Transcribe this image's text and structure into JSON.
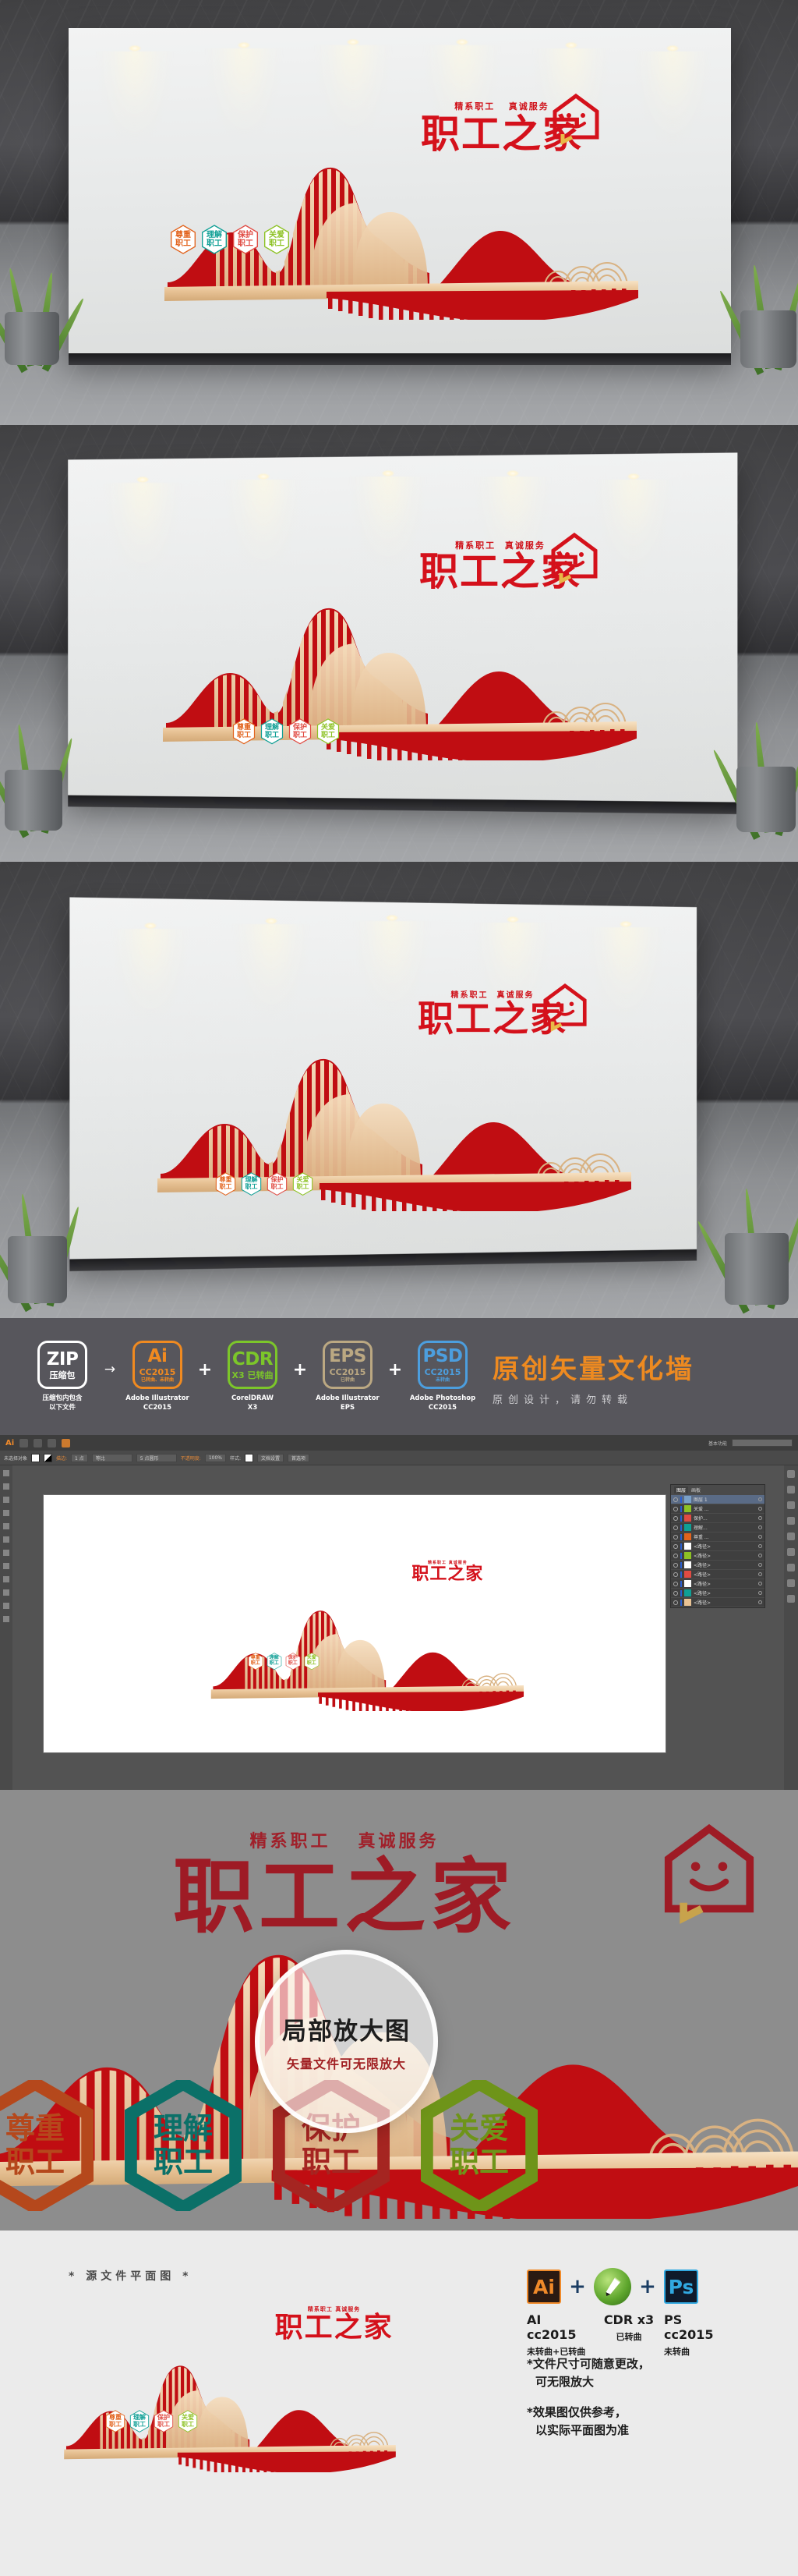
{
  "artwork": {
    "main_title": "职工之家",
    "sub_title_left": "精系职工",
    "sub_title_right": "真诚服务",
    "hexes": [
      {
        "line1": "尊重",
        "line2": "职工",
        "color": "#e2631d"
      },
      {
        "line1": "理解",
        "line2": "职工",
        "color": "#0f9f95"
      },
      {
        "line1": "保护",
        "line2": "职工",
        "color": "#e04b43"
      },
      {
        "line1": "关爱",
        "line2": "职工",
        "color": "#8dc224"
      }
    ],
    "colors": {
      "mountain_red": "#c00d12",
      "gold": "#e9c394",
      "title_red": "#d4111b",
      "wall": "#eceded"
    }
  },
  "package_strip": {
    "formats": [
      {
        "big": "ZIP",
        "sub": "压缩包",
        "sub2": "",
        "color": "#ffffff",
        "caption": "压缩包内包含\n以下文件"
      },
      {
        "big": "Ai",
        "sub": "CC2015",
        "sub2": "已转曲、未转曲",
        "color": "#f08a20",
        "caption": "Adobe Illustrator\nCC2015"
      },
      {
        "big": "CDR",
        "sub": "X3 已转曲",
        "sub2": "",
        "color": "#7cc62a",
        "caption": "CorelDRAW\nX3"
      },
      {
        "big": "EPS",
        "sub": "CC2015",
        "sub2": "已转曲",
        "color": "#bba882",
        "caption": "Adobe Illustrator\nEPS"
      },
      {
        "big": "PSD",
        "sub": "CC2015",
        "sub2": "未转曲",
        "color": "#4c9ede",
        "caption": "Adobe Photoshop\nCC2015"
      }
    ],
    "separators": [
      "→",
      "+",
      "+",
      "+"
    ],
    "title": "原创矢量文化墙",
    "subtitle": "原创设计，请勿转载",
    "title_color": "#ee8a20",
    "background": "#57565c"
  },
  "ai_window": {
    "app_name": "Ai",
    "workspace_label": "基本功能",
    "control_bar": {
      "no_selection": "未选择对象",
      "stroke_label": "描边:",
      "stroke_weight": "1 点",
      "style_line": "等比",
      "opacity_label": "不透明度:",
      "opacity_value": "100%",
      "style_label": "样式:",
      "doc_setup": "文档设置",
      "preferences": "首选项",
      "brush_label": "5 点圆形"
    },
    "layers_panel": {
      "tabs": [
        "图层",
        "画板"
      ],
      "rows": [
        {
          "name": "图层 1",
          "selected": true
        },
        {
          "name": "关爱 ...",
          "selected": false
        },
        {
          "name": "保护...",
          "selected": false
        },
        {
          "name": "理解...",
          "selected": false
        },
        {
          "name": "尊重 ...",
          "selected": false
        },
        {
          "name": "<路径>",
          "selected": false
        },
        {
          "name": "<路径>",
          "selected": false
        },
        {
          "name": "<路径>",
          "selected": false
        },
        {
          "name": "<路径>",
          "selected": false
        },
        {
          "name": "<路径>",
          "selected": false
        },
        {
          "name": "<路径>",
          "selected": false
        },
        {
          "name": "<路径>",
          "selected": false
        }
      ]
    }
  },
  "zoom_detail": {
    "headline": "局部放大图",
    "subline": "矢量文件可无限放大",
    "background": "#8d8d8d"
  },
  "footer": {
    "plan_note": "* 源文件平面图 *",
    "software": [
      {
        "name": "AI cc2015",
        "note": "未转曲+已转曲",
        "icon": "illustrator-icon",
        "glyph": "Ai"
      },
      {
        "name": "CDR x3",
        "note": "已转曲",
        "icon": "coreldraw-icon",
        "glyph": ""
      },
      {
        "name": "PS cc2015",
        "note": "未转曲",
        "icon": "photoshop-icon",
        "glyph": "Ps"
      }
    ],
    "plus": "+",
    "rules": [
      {
        "l1": "*文件尺寸可随意更改，",
        "l2": "可无限放大"
      },
      {
        "l1": "*效果图仅供参考，",
        "l2": "以实际平面图为准"
      }
    ]
  }
}
